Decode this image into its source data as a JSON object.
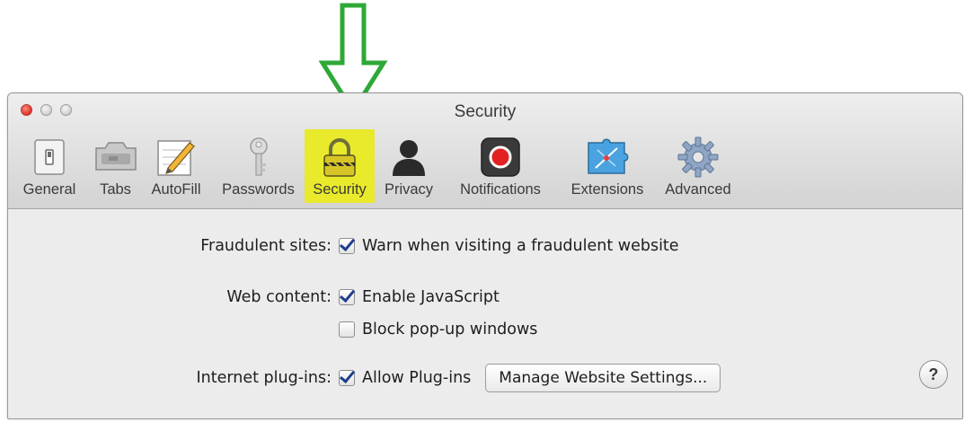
{
  "window": {
    "title": "Security"
  },
  "toolbar": {
    "items": [
      {
        "label": "General",
        "icon": "general-switch-icon"
      },
      {
        "label": "Tabs",
        "icon": "tabs-icon"
      },
      {
        "label": "AutoFill",
        "icon": "autofill-pencil-icon"
      },
      {
        "label": "Passwords",
        "icon": "key-icon"
      },
      {
        "label": "Security",
        "icon": "padlock-icon",
        "selected": true,
        "highlight_color": "#e8ea2b"
      },
      {
        "label": "Privacy",
        "icon": "person-silhouette-icon"
      },
      {
        "label": "Notifications",
        "icon": "notification-record-icon"
      },
      {
        "label": "Extensions",
        "icon": "puzzle-compass-icon"
      },
      {
        "label": "Advanced",
        "icon": "gear-icon"
      }
    ]
  },
  "annotation": {
    "icon": "green-down-arrow-icon",
    "color": "#2ea836"
  },
  "security": {
    "fraudulent": {
      "label": "Fraudulent sites:",
      "option": "Warn when visiting a fraudulent website",
      "checked": true
    },
    "web_content": {
      "label": "Web content:",
      "javascript": {
        "option": "Enable JavaScript",
        "checked": true
      },
      "popups": {
        "option": "Block pop-up windows",
        "checked": false
      }
    },
    "plugins": {
      "label": "Internet plug-ins:",
      "option": "Allow Plug-ins",
      "checked": true,
      "manage_button": "Manage Website Settings..."
    },
    "help_label": "?"
  }
}
